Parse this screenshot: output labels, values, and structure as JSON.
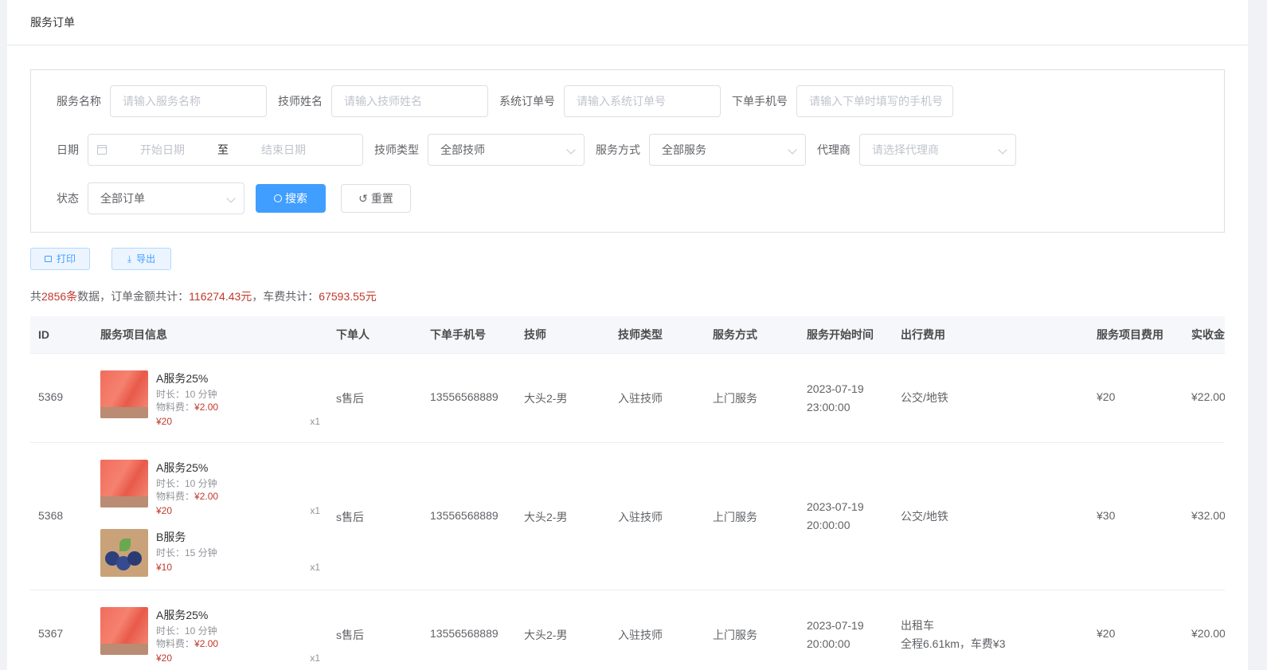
{
  "header": {
    "title": "服务订单"
  },
  "filters": {
    "service_name": {
      "label": "服务名称",
      "placeholder": "请输入服务名称"
    },
    "tech_name": {
      "label": "技师姓名",
      "placeholder": "请输入技师姓名"
    },
    "order_no": {
      "label": "系统订单号",
      "placeholder": "请输入系统订单号"
    },
    "phone": {
      "label": "下单手机号",
      "placeholder": "请输入下单时填写的手机号"
    },
    "date": {
      "label": "日期",
      "start_placeholder": "开始日期",
      "separator": "至",
      "end_placeholder": "结束日期"
    },
    "tech_type": {
      "label": "技师类型",
      "value": "全部技师"
    },
    "service_mode": {
      "label": "服务方式",
      "value": "全部服务"
    },
    "agent": {
      "label": "代理商",
      "placeholder": "请选择代理商"
    },
    "status": {
      "label": "状态",
      "value": "全部订单"
    },
    "search_label": "搜索",
    "reset_label": "重置"
  },
  "toolbar": {
    "print_label": "打印",
    "export_label": "导出"
  },
  "summary": {
    "prefix": "共",
    "count": "2856条",
    "text1": "数据，订单金额共计：",
    "amount": "116274.43元",
    "text2": "，车费共计：",
    "fare": "67593.55元"
  },
  "table": {
    "columns": [
      "ID",
      "服务项目信息",
      "下单人",
      "下单手机号",
      "技师",
      "技师类型",
      "服务方式",
      "服务开始时间",
      "出行费用",
      "服务项目费用",
      "实收金"
    ],
    "rows": [
      {
        "id": "5369",
        "items": [
          {
            "name": "A服务25%",
            "duration": "时长：10 分钟",
            "material_label": "物料费：",
            "material": "¥2.00",
            "price": "¥20",
            "qty": "x1"
          }
        ],
        "customer": "s售后",
        "phone": "13556568889",
        "tech": "大头2-男",
        "tech_type": "入驻技师",
        "mode": "上门服务",
        "date": "2023-07-19",
        "time": "23:00:00",
        "travel1": "公交/地铁",
        "travel2": "",
        "fee": "¥20",
        "received": "¥22.00"
      },
      {
        "id": "5368",
        "items": [
          {
            "name": "A服务25%",
            "duration": "时长：10 分钟",
            "material_label": "物料费：",
            "material": "¥2.00",
            "price": "¥20",
            "qty": "x1"
          },
          {
            "name": "B服务",
            "duration": "时长：15 分钟",
            "price": "¥10",
            "qty": "x1"
          }
        ],
        "customer": "s售后",
        "phone": "13556568889",
        "tech": "大头2-男",
        "tech_type": "入驻技师",
        "mode": "上门服务",
        "date": "2023-07-19",
        "time": "20:00:00",
        "travel1": "公交/地铁",
        "travel2": "",
        "fee": "¥30",
        "received": "¥32.00"
      },
      {
        "id": "5367",
        "items": [
          {
            "name": "A服务25%",
            "duration": "时长：10 分钟",
            "material_label": "物料费：",
            "material": "¥2.00",
            "price": "¥20",
            "qty": "x1"
          }
        ],
        "customer": "s售后",
        "phone": "13556568889",
        "tech": "大头2-男",
        "tech_type": "入驻技师",
        "mode": "上门服务",
        "date": "2023-07-19",
        "time": "20:00:00",
        "travel1": "出租车",
        "travel2": "全程6.61km，车费¥3",
        "fee": "¥20",
        "received": "¥20.00"
      }
    ]
  }
}
